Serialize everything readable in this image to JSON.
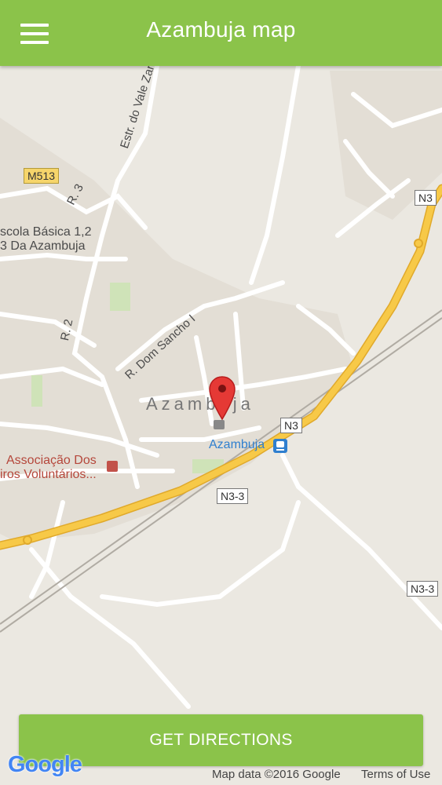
{
  "appbar": {
    "title": "Azambuja map",
    "menu_icon": "hamburger-menu-icon"
  },
  "map": {
    "town_label": "Azambuja",
    "station_label": "Azambuja",
    "road_labels": {
      "estr_vale": "Estr. do Vale Zar",
      "r3": "R. 3",
      "r2": "R. 2",
      "dom_sancho": "R. Dom Sancho I"
    },
    "shields": {
      "m513": "M513",
      "n3_top": "N3",
      "n3_mid": "N3",
      "n33_mid": "N3-3",
      "n33_right": "N3-3"
    },
    "poi": {
      "school_line1": "scola Básica 1,2",
      "school_line2": "3 Da Azambuja",
      "assoc_line1": "Associação Dos",
      "assoc_line2": "iros Voluntários..."
    },
    "colors": {
      "land": "#ebe8e1",
      "road": "#ffffff",
      "highway": "#f7c948",
      "accent": "#8bc34a",
      "marker": "#e53935"
    }
  },
  "actions": {
    "directions_label": "GET DIRECTIONS"
  },
  "attribution": {
    "logo": "Google",
    "map_data": "Map data ©2016 Google",
    "terms": "Terms of Use"
  }
}
